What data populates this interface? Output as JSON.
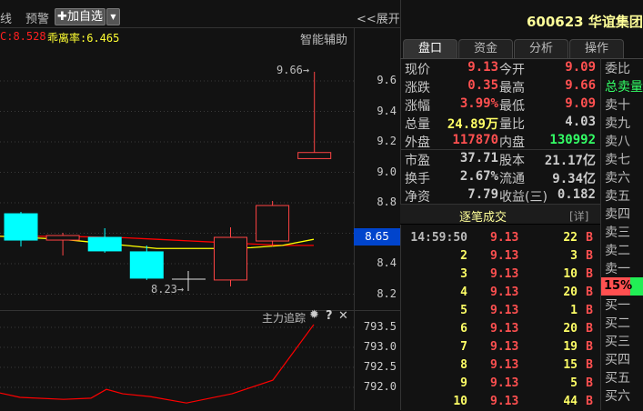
{
  "toolbar": {
    "left_cut": "线",
    "alert": "预警",
    "add_watch": "✚加自选",
    "dropdown": "▼",
    "expand": "<<展开"
  },
  "info": {
    "ma_label": "C:8.528",
    "deviation": "乖离率:6.465",
    "assist": "智能辅助"
  },
  "chart_data": {
    "type": "candlestick",
    "ylim": [
      8.1,
      9.75
    ],
    "yticks": [
      "9.6",
      "9.4",
      "9.2",
      "9.0",
      "8.8",
      "8.4",
      "8.2"
    ],
    "current_price_label": "8.65",
    "candles": [
      {
        "o": 8.728,
        "h": 8.74,
        "l": 8.513,
        "c": 8.555
      },
      {
        "o": 8.555,
        "h": 8.603,
        "l": 8.454,
        "c": 8.585
      },
      {
        "o": 8.573,
        "h": 8.633,
        "l": 8.472,
        "c": 8.484
      },
      {
        "o": 8.478,
        "h": 8.519,
        "l": 8.293,
        "c": 8.305
      },
      null,
      {
        "o": 8.293,
        "h": 8.639,
        "l": 8.251,
        "c": 8.573
      },
      {
        "o": 8.549,
        "h": 8.812,
        "l": 8.513,
        "c": 8.782
      },
      {
        "o": 9.09,
        "h": 9.66,
        "l": 9.09,
        "c": 9.13
      }
    ],
    "ma_red": [
      8.58,
      8.58,
      8.58,
      8.575,
      8.57,
      8.56,
      8.55,
      8.54,
      8.53,
      8.52,
      8.52
    ],
    "ma_yellow": [
      8.58,
      8.57,
      8.56,
      8.54,
      8.52,
      8.5,
      8.5,
      8.5,
      8.505,
      8.52,
      8.56
    ],
    "high_label": "9.66",
    "low_label": "8.23",
    "up_color": "#ff4444",
    "down_color": "#00ffff"
  },
  "indicator": {
    "title": "主力追踪",
    "gear": "gear-icon",
    "help": "?",
    "close": "✕",
    "yticks": [
      "793.5",
      "793.0",
      "792.5",
      "792.0"
    ],
    "ylim": [
      791.5,
      793.7
    ],
    "values": [
      791.86,
      791.75,
      791.7,
      791.73,
      791.95,
      791.84,
      791.77,
      791.61,
      791.84,
      792.18,
      793.57
    ],
    "line_color": "#ff0000"
  },
  "stock": {
    "code": "600623",
    "name": "华谊集团"
  },
  "tabs": [
    "盘口",
    "资金",
    "分析",
    "操作"
  ],
  "quote": [
    [
      {
        "l": "现价",
        "v": "9.13",
        "c": "#ff5050"
      },
      {
        "l": "今开",
        "v": "9.09",
        "c": "#ff5050"
      }
    ],
    [
      {
        "l": "涨跌",
        "v": "0.35",
        "c": "#ff5050"
      },
      {
        "l": "最高",
        "v": "9.66",
        "c": "#ff5050"
      }
    ],
    [
      {
        "l": "涨幅",
        "v": "3.99%",
        "c": "#ff5050"
      },
      {
        "l": "最低",
        "v": "9.09",
        "c": "#ff5050"
      }
    ],
    [
      {
        "l": "总量",
        "v": "24.89万",
        "c": "#ffff66"
      },
      {
        "l": "量比",
        "v": "4.03",
        "c": "#cccccc"
      }
    ],
    [
      {
        "l": "外盘",
        "v": "117870",
        "c": "#ff5050"
      },
      {
        "l": "内盘",
        "v": "130992",
        "c": "#33ff66"
      }
    ],
    [
      {
        "l": "市盈",
        "v": "37.71",
        "c": "#cccccc"
      },
      {
        "l": "股本",
        "v": "21.17亿",
        "c": "#cccccc"
      }
    ],
    [
      {
        "l": "换手",
        "v": "2.67%",
        "c": "#cccccc"
      },
      {
        "l": "流通",
        "v": "9.34亿",
        "c": "#cccccc"
      }
    ],
    [
      {
        "l": "净资",
        "v": "7.79",
        "c": "#cccccc"
      },
      {
        "l": "收益(三)",
        "v": "0.182",
        "c": "#cccccc"
      }
    ]
  ],
  "trades_header": {
    "title": "逐笔成交",
    "detail": "[详]"
  },
  "trades": [
    {
      "t": "14:59:50",
      "p": "9.13",
      "v": "22",
      "s": "B"
    },
    {
      "t": "2",
      "p": "9.13",
      "v": "3",
      "s": "B"
    },
    {
      "t": "3",
      "p": "9.13",
      "v": "10",
      "s": "B"
    },
    {
      "t": "4",
      "p": "9.13",
      "v": "20",
      "s": "B"
    },
    {
      "t": "5",
      "p": "9.13",
      "v": "1",
      "s": "B"
    },
    {
      "t": "6",
      "p": "9.13",
      "v": "20",
      "s": "B"
    },
    {
      "t": "7",
      "p": "9.13",
      "v": "19",
      "s": "B"
    },
    {
      "t": "8",
      "p": "9.13",
      "v": "15",
      "s": "B"
    },
    {
      "t": "9",
      "p": "9.13",
      "v": "5",
      "s": "B"
    },
    {
      "t": "10",
      "p": "9.13",
      "v": "44",
      "s": "B"
    }
  ],
  "side_labels": [
    "委比",
    "总卖量",
    "卖十",
    "卖九",
    "卖八",
    "卖七",
    "卖六",
    "卖五",
    "卖四",
    "卖三",
    "卖二",
    "卖一",
    "15%",
    "买一",
    "买二",
    "买三",
    "买四",
    "买五",
    "买六"
  ]
}
